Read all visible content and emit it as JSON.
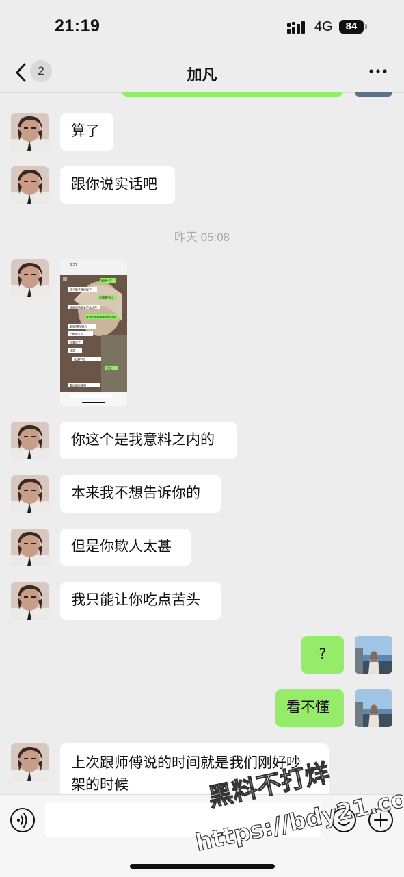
{
  "status": {
    "time": "21:19",
    "network": "4G",
    "battery": "84"
  },
  "header": {
    "back_badge": "2",
    "title": "加凡"
  },
  "messages": [
    {
      "text": "算了"
    },
    {
      "text": "跟你说实话吧"
    },
    {
      "timestamp": "昨天 05:08"
    },
    {
      "text": "你这个是我意料之内的"
    },
    {
      "text": "本来我不想告诉你的"
    },
    {
      "text": "但是你欺人太甚"
    },
    {
      "text": "我只能让你吃点苦头"
    },
    {
      "text": "?"
    },
    {
      "text": "看不懂"
    },
    {
      "text_line1": "上次跟师傅说的时间就是我们刚好吵",
      "text_line2": "架的时候"
    }
  ],
  "image_message": {
    "time": "3:57",
    "lines": [
      "能帮一下",
      "这个能不能修复下",
      "在线都可以",
      "锁屏的话就会不会给你",
      "这里的我都能看到什么样",
      "解锁/删除照片",
      "一群别人的",
      "你要好了",
      "还是",
      "就这样吧",
      "下次",
      "最后跟你说吧"
    ]
  },
  "watermark": {
    "line1": "黑料不打烊",
    "line2": "https://bdy21.co"
  },
  "colors": {
    "bg": "#ededed",
    "sent_bubble": "#95ec69",
    "received_bubble": "#ffffff",
    "input_bar": "#f6f6f6"
  },
  "icons": [
    "signal-icon",
    "back-icon",
    "more-icon",
    "voice-icon",
    "emoji-icon",
    "plus-icon"
  ]
}
